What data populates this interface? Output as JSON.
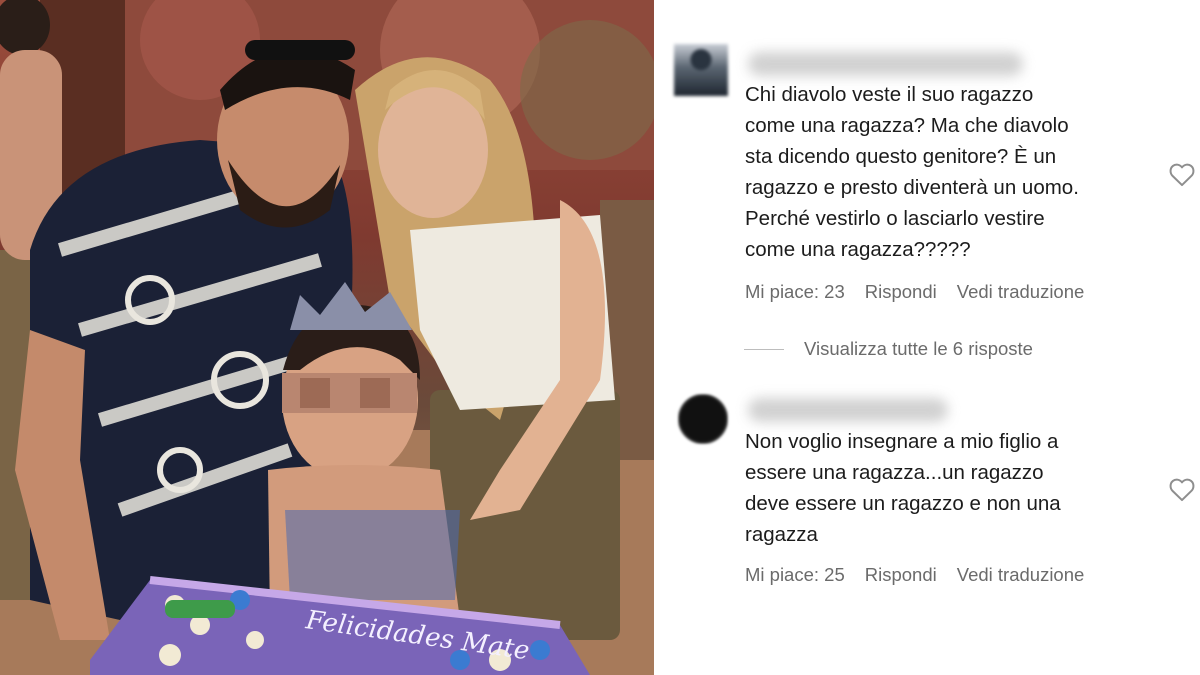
{
  "photo": {
    "cake_text": "Felicidades Mate"
  },
  "comments": [
    {
      "text": "Chi diavolo veste il suo ragazzo\ncome una ragazza? Ma che diavolo\nsta dicendo questo genitore? È un\nragazzo e presto diventerà un uomo.\nPerché vestirlo o lasciarlo vestire\ncome una ragazza?????",
      "likes_label": "Mi piace: 23",
      "reply_label": "Rispondi",
      "translate_label": "Vedi traduzione",
      "like_icon": "heart-outline-icon"
    },
    {
      "text": "Non voglio insegnare a mio figlio a\nessere una ragazza...un ragazzo\ndeve essere un ragazzo e non una\nragazza",
      "likes_label": "Mi piace: 25",
      "reply_label": "Rispondi",
      "translate_label": "Vedi traduzione",
      "like_icon": "heart-outline-icon"
    }
  ],
  "view_replies_label": "Visualizza tutte le 6 risposte",
  "colors": {
    "text": "#1c1c1c",
    "secondary_text": "#6b6b6b",
    "background": "#ffffff"
  }
}
